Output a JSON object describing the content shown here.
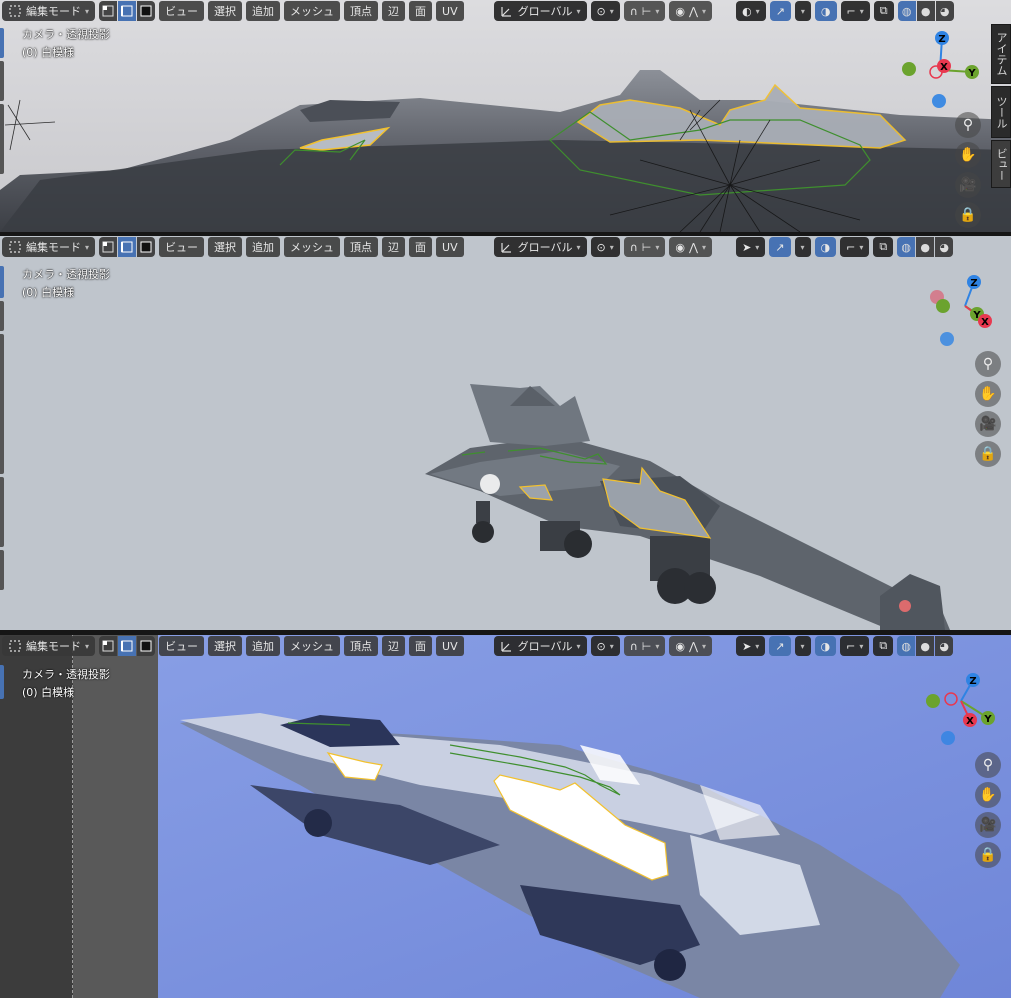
{
  "header": {
    "mode_label": "編集モード",
    "menus": [
      "ビュー",
      "選択",
      "追加",
      "メッシュ",
      "頂点",
      "辺",
      "面",
      "UV"
    ],
    "orientation_label": "グローバル"
  },
  "overlay": {
    "view_name": "カメラ・透視投影",
    "object_name": "(0) 白模様"
  },
  "gizmo": {
    "z": "Z",
    "x": "X",
    "y": "Y"
  },
  "sidebar_tabs": [
    "アイテム",
    "ツール",
    "ビュー"
  ],
  "colors": {
    "accent": "#4772b3",
    "header_bg": "#383838",
    "gizmo_x": "#e8384f",
    "gizmo_y": "#6ba32e",
    "gizmo_z": "#2f83e3",
    "selection_edge": "#f2c12e",
    "mesh_edge": "#3f8f2e"
  },
  "icons": {
    "editor_type": "mesh-editor-icon",
    "select_modes": [
      "vertex-select-icon",
      "edge-select-icon",
      "face-select-icon"
    ],
    "nav": [
      "zoom-icon",
      "hand-icon",
      "camera-icon",
      "lock-icon"
    ]
  }
}
